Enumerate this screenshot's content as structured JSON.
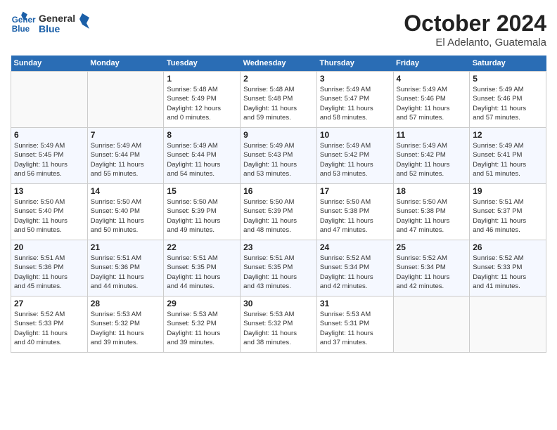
{
  "header": {
    "logo_line1": "General",
    "logo_line2": "Blue",
    "month": "October 2024",
    "location": "El Adelanto, Guatemala"
  },
  "weekdays": [
    "Sunday",
    "Monday",
    "Tuesday",
    "Wednesday",
    "Thursday",
    "Friday",
    "Saturday"
  ],
  "weeks": [
    [
      {
        "day": "",
        "info": ""
      },
      {
        "day": "",
        "info": ""
      },
      {
        "day": "1",
        "info": "Sunrise: 5:48 AM\nSunset: 5:49 PM\nDaylight: 12 hours\nand 0 minutes."
      },
      {
        "day": "2",
        "info": "Sunrise: 5:48 AM\nSunset: 5:48 PM\nDaylight: 11 hours\nand 59 minutes."
      },
      {
        "day": "3",
        "info": "Sunrise: 5:49 AM\nSunset: 5:47 PM\nDaylight: 11 hours\nand 58 minutes."
      },
      {
        "day": "4",
        "info": "Sunrise: 5:49 AM\nSunset: 5:46 PM\nDaylight: 11 hours\nand 57 minutes."
      },
      {
        "day": "5",
        "info": "Sunrise: 5:49 AM\nSunset: 5:46 PM\nDaylight: 11 hours\nand 57 minutes."
      }
    ],
    [
      {
        "day": "6",
        "info": "Sunrise: 5:49 AM\nSunset: 5:45 PM\nDaylight: 11 hours\nand 56 minutes."
      },
      {
        "day": "7",
        "info": "Sunrise: 5:49 AM\nSunset: 5:44 PM\nDaylight: 11 hours\nand 55 minutes."
      },
      {
        "day": "8",
        "info": "Sunrise: 5:49 AM\nSunset: 5:44 PM\nDaylight: 11 hours\nand 54 minutes."
      },
      {
        "day": "9",
        "info": "Sunrise: 5:49 AM\nSunset: 5:43 PM\nDaylight: 11 hours\nand 53 minutes."
      },
      {
        "day": "10",
        "info": "Sunrise: 5:49 AM\nSunset: 5:42 PM\nDaylight: 11 hours\nand 53 minutes."
      },
      {
        "day": "11",
        "info": "Sunrise: 5:49 AM\nSunset: 5:42 PM\nDaylight: 11 hours\nand 52 minutes."
      },
      {
        "day": "12",
        "info": "Sunrise: 5:49 AM\nSunset: 5:41 PM\nDaylight: 11 hours\nand 51 minutes."
      }
    ],
    [
      {
        "day": "13",
        "info": "Sunrise: 5:50 AM\nSunset: 5:40 PM\nDaylight: 11 hours\nand 50 minutes."
      },
      {
        "day": "14",
        "info": "Sunrise: 5:50 AM\nSunset: 5:40 PM\nDaylight: 11 hours\nand 50 minutes."
      },
      {
        "day": "15",
        "info": "Sunrise: 5:50 AM\nSunset: 5:39 PM\nDaylight: 11 hours\nand 49 minutes."
      },
      {
        "day": "16",
        "info": "Sunrise: 5:50 AM\nSunset: 5:39 PM\nDaylight: 11 hours\nand 48 minutes."
      },
      {
        "day": "17",
        "info": "Sunrise: 5:50 AM\nSunset: 5:38 PM\nDaylight: 11 hours\nand 47 minutes."
      },
      {
        "day": "18",
        "info": "Sunrise: 5:50 AM\nSunset: 5:38 PM\nDaylight: 11 hours\nand 47 minutes."
      },
      {
        "day": "19",
        "info": "Sunrise: 5:51 AM\nSunset: 5:37 PM\nDaylight: 11 hours\nand 46 minutes."
      }
    ],
    [
      {
        "day": "20",
        "info": "Sunrise: 5:51 AM\nSunset: 5:36 PM\nDaylight: 11 hours\nand 45 minutes."
      },
      {
        "day": "21",
        "info": "Sunrise: 5:51 AM\nSunset: 5:36 PM\nDaylight: 11 hours\nand 44 minutes."
      },
      {
        "day": "22",
        "info": "Sunrise: 5:51 AM\nSunset: 5:35 PM\nDaylight: 11 hours\nand 44 minutes."
      },
      {
        "day": "23",
        "info": "Sunrise: 5:51 AM\nSunset: 5:35 PM\nDaylight: 11 hours\nand 43 minutes."
      },
      {
        "day": "24",
        "info": "Sunrise: 5:52 AM\nSunset: 5:34 PM\nDaylight: 11 hours\nand 42 minutes."
      },
      {
        "day": "25",
        "info": "Sunrise: 5:52 AM\nSunset: 5:34 PM\nDaylight: 11 hours\nand 42 minutes."
      },
      {
        "day": "26",
        "info": "Sunrise: 5:52 AM\nSunset: 5:33 PM\nDaylight: 11 hours\nand 41 minutes."
      }
    ],
    [
      {
        "day": "27",
        "info": "Sunrise: 5:52 AM\nSunset: 5:33 PM\nDaylight: 11 hours\nand 40 minutes."
      },
      {
        "day": "28",
        "info": "Sunrise: 5:53 AM\nSunset: 5:32 PM\nDaylight: 11 hours\nand 39 minutes."
      },
      {
        "day": "29",
        "info": "Sunrise: 5:53 AM\nSunset: 5:32 PM\nDaylight: 11 hours\nand 39 minutes."
      },
      {
        "day": "30",
        "info": "Sunrise: 5:53 AM\nSunset: 5:32 PM\nDaylight: 11 hours\nand 38 minutes."
      },
      {
        "day": "31",
        "info": "Sunrise: 5:53 AM\nSunset: 5:31 PM\nDaylight: 11 hours\nand 37 minutes."
      },
      {
        "day": "",
        "info": ""
      },
      {
        "day": "",
        "info": ""
      }
    ]
  ]
}
